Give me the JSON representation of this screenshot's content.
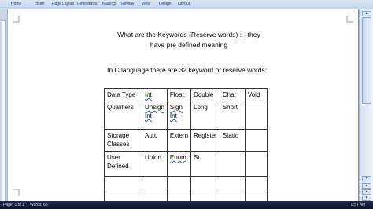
{
  "ribbon": {
    "tabs": [
      "Home",
      "Insert",
      "Page Layout",
      "References",
      "Mailings",
      "Review",
      "View",
      "Design",
      "Layout"
    ]
  },
  "document": {
    "heading_pre": "What are the Keywords (Reserve ",
    "heading_underlined": "words)",
    "heading_colon": " : ",
    "heading_post": "- they have pre defined meaning",
    "subheading": "In C language there are 32 keyword or reserve words:",
    "table": {
      "rows": [
        [
          "Data Type",
          "Int",
          "Float",
          "Double",
          "Char",
          "Void"
        ],
        [
          "Qualifiers",
          "Unsign Int",
          "Sign Int",
          "Long",
          "Short",
          ""
        ],
        [
          "Storage Classes",
          "Auto",
          "Extern",
          "Register",
          "Static",
          ""
        ],
        [
          "User Defined",
          "Union",
          "Enum",
          "St",
          "",
          ""
        ],
        [
          "",
          "",
          "",
          "",
          "",
          ""
        ],
        [
          "",
          "",
          "",
          "",
          "",
          ""
        ]
      ]
    }
  },
  "statusbar": {
    "page": "Page: 1 of 1",
    "words": "Words: 65",
    "clock": "9:57 AM"
  },
  "colors": {
    "ribbon": "#c4d6ec",
    "statusbar": "#1e2d4d",
    "spelling_mark": "#2a56b8"
  }
}
